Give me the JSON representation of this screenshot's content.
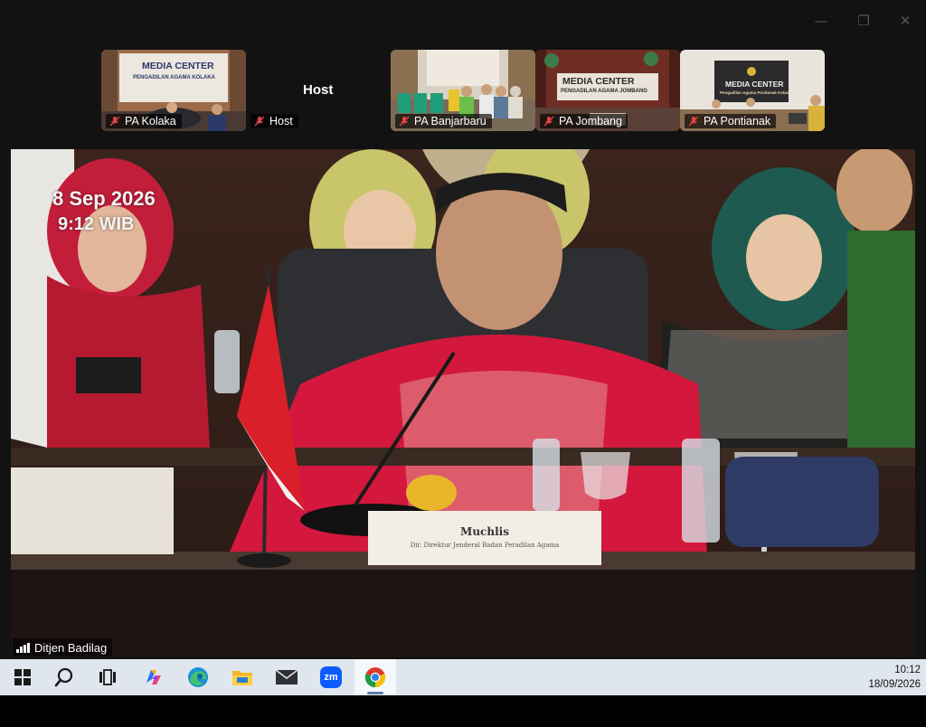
{
  "window": {
    "minimize_glyph": "—",
    "maximize_glyph": "❐",
    "close_glyph": "✕"
  },
  "participants": [
    {
      "name": "PA Kolaka",
      "muted": true,
      "sign": "MEDIA CENTER",
      "sign_sub": "PENGADILAN AGAMA KOLAKA"
    },
    {
      "name": "Host",
      "muted": true
    },
    {
      "name": "PA Banjarbaru",
      "muted": true
    },
    {
      "name": "PA Jombang",
      "muted": true,
      "sign": "MEDIA CENTER",
      "sign_sub": "PENGADILAN AGAMA JOMBANG"
    },
    {
      "name": "PA Pontianak",
      "muted": true,
      "sign": "MEDIA CENTER",
      "sign_sub": "Pengadilan Agama Pontianak Kelas IA"
    }
  ],
  "host_label": "Host",
  "main_video": {
    "timestamp_date": "8 Sep 2026",
    "timestamp_time": "9:12 WIB",
    "nameplate_name": "Muchlis",
    "nameplate_title": "Dir. Direktur Jenderal Badan Peradilan Agama",
    "speaker_name": "Ditjen Badilag"
  },
  "taskbar": {
    "items": [
      "start",
      "search",
      "task-view",
      "copilot",
      "edge",
      "file-explorer",
      "mail",
      "zoom",
      "chrome"
    ],
    "active": "chrome",
    "zoom_label": "zm"
  },
  "clock": {
    "time": "10:12",
    "date": "18/09/2026"
  },
  "colors": {
    "accent": "#5b7ea9",
    "mic_off": "#e04343",
    "taskbar_bg": "#dfe6ee"
  }
}
